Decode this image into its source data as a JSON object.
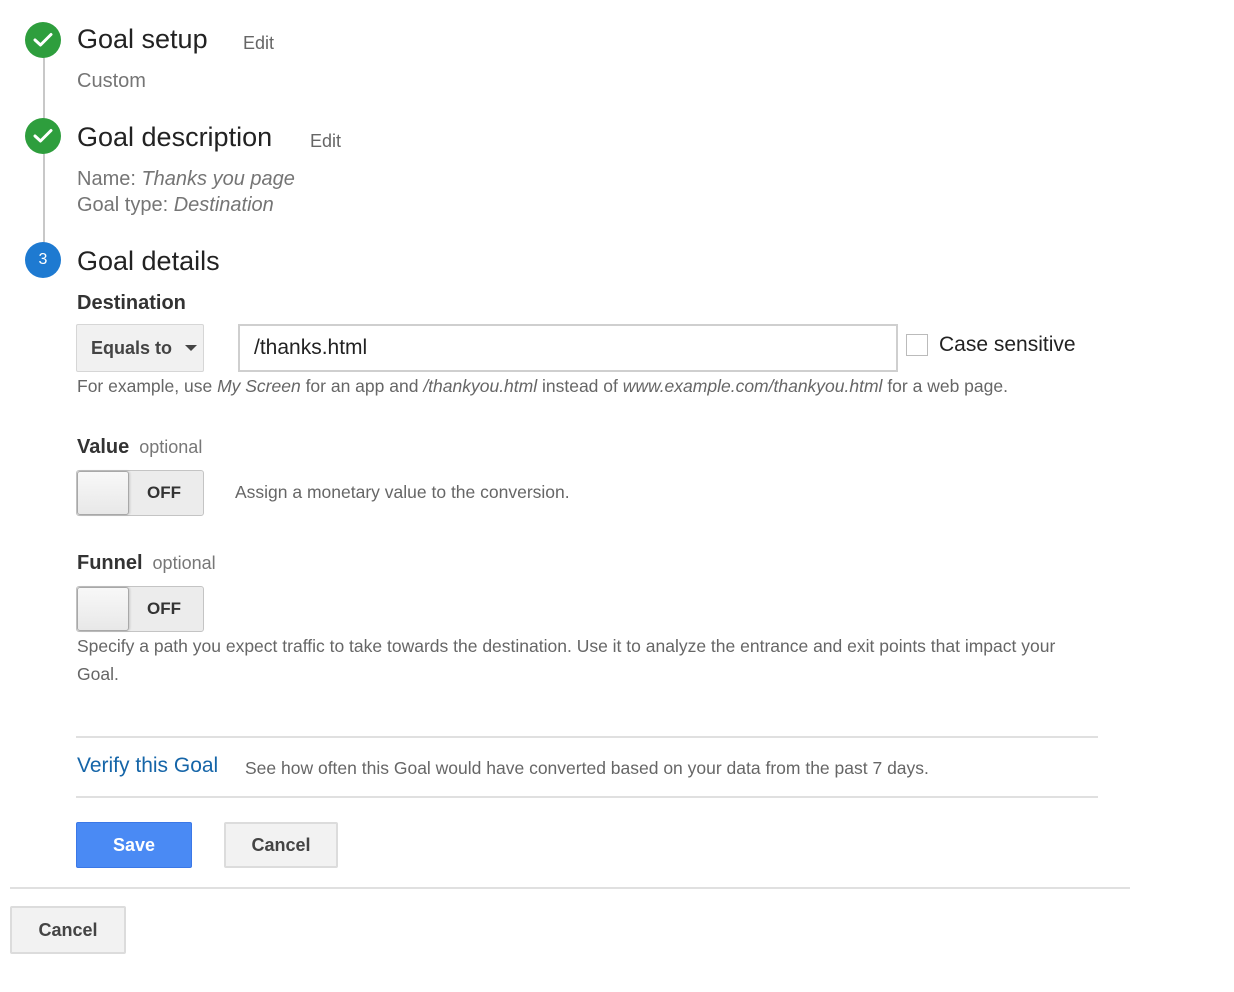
{
  "steps": [
    {
      "number": "1",
      "status": "complete",
      "title": "Goal setup",
      "edit_label": "Edit",
      "summary": "Custom"
    },
    {
      "number": "2",
      "status": "complete",
      "title": "Goal description",
      "edit_label": "Edit",
      "name_label": "Name:",
      "name_value": "Thanks you page",
      "type_label": "Goal type:",
      "type_value": "Destination"
    },
    {
      "number": "3",
      "status": "active",
      "title": "Goal details"
    }
  ],
  "destination": {
    "label": "Destination",
    "match_type": "Equals to",
    "value": "/thanks.html",
    "case_sensitive_label": "Case sensitive",
    "case_sensitive_checked": false,
    "help": {
      "p1": "For example, use ",
      "e1": "My Screen",
      "p2": " for an app and ",
      "e2": "/thankyou.html",
      "p3": " instead of ",
      "e3": "www.example.com/thankyou.html",
      "p4": " for a web page."
    }
  },
  "value_section": {
    "label": "Value",
    "optional": "optional",
    "toggle_state": "OFF",
    "description": "Assign a monetary value to the conversion."
  },
  "funnel_section": {
    "label": "Funnel",
    "optional": "optional",
    "toggle_state": "OFF",
    "description_line1": "Specify a path you expect traffic to take towards the destination. Use it to analyze the entrance and exit points that impact your",
    "description_line2": "Goal."
  },
  "verify": {
    "link": "Verify this Goal",
    "description": "See how often this Goal would have converted based on your data from the past 7 days."
  },
  "actions": {
    "save": "Save",
    "cancel": "Cancel",
    "outer_cancel": "Cancel"
  },
  "colors": {
    "complete": "#2e9e3d",
    "active": "#1e7ad1",
    "link": "#1565a8",
    "primary_button": "#4a8af4"
  }
}
